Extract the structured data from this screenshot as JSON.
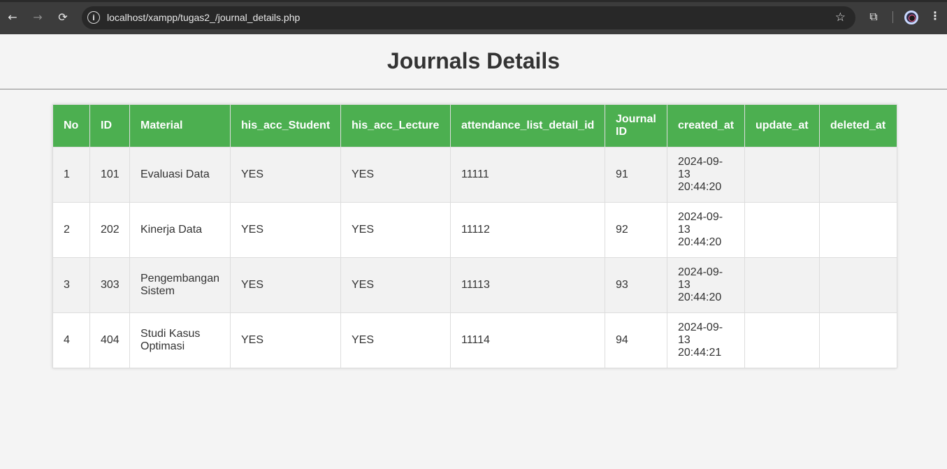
{
  "browser": {
    "url": "localhost/xampp/tugas2_/journal_details.php",
    "back_icon": "←",
    "forward_icon": "→",
    "reload_icon": "⟳",
    "info_icon": "i",
    "star_icon": "☆",
    "extensions_icon": "⧉",
    "menu_icon": "⋮"
  },
  "page": {
    "title": "Journals Details"
  },
  "table": {
    "headers": [
      "No",
      "ID",
      "Material",
      "his_acc_Student",
      "his_acc_Lecture",
      "attendance_list_detail_id",
      "Journal ID",
      "created_at",
      "update_at",
      "deleted_at"
    ],
    "rows": [
      [
        "1",
        "101",
        "Evaluasi Data",
        "YES",
        "YES",
        "11111",
        "91",
        "2024-09-13 20:44:20",
        "",
        ""
      ],
      [
        "2",
        "202",
        "Kinerja Data",
        "YES",
        "YES",
        "11112",
        "92",
        "2024-09-13 20:44:20",
        "",
        ""
      ],
      [
        "3",
        "303",
        "Pengembangan Sistem",
        "YES",
        "YES",
        "11113",
        "93",
        "2024-09-13 20:44:20",
        "",
        ""
      ],
      [
        "4",
        "404",
        "Studi Kasus Optimasi",
        "YES",
        "YES",
        "11114",
        "94",
        "2024-09-13 20:44:21",
        "",
        ""
      ]
    ]
  },
  "colors": {
    "header_bg": "#4caf50",
    "header_text": "#ffffff",
    "stripe": "#f2f2f2"
  }
}
